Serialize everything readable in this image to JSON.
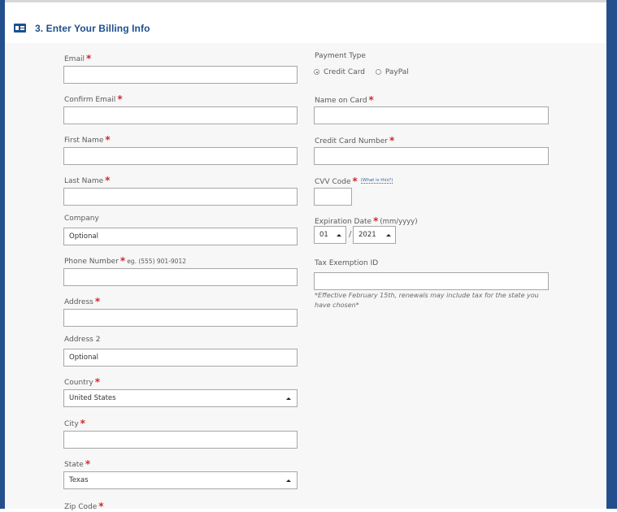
{
  "section": {
    "title": "3. Enter Your Billing Info",
    "icon": "id-card-icon"
  },
  "left_fields": [
    {
      "label": "Email",
      "required": true,
      "value": "",
      "placeholder": ""
    },
    {
      "label": "Confirm Email",
      "required": true,
      "value": "",
      "placeholder": ""
    },
    {
      "label": "First Name",
      "required": true,
      "value": "",
      "placeholder": ""
    },
    {
      "label": "Last Name",
      "required": true,
      "value": "",
      "placeholder": ""
    },
    {
      "label": "Company",
      "required": false,
      "value": "",
      "placeholder": "Optional"
    },
    {
      "label": "Phone Number",
      "required": true,
      "hint": "eg. (555) 901-9012",
      "value": "",
      "placeholder": ""
    },
    {
      "label": "Address",
      "required": true,
      "value": "",
      "placeholder": ""
    },
    {
      "label": "Address 2",
      "required": false,
      "value": "",
      "placeholder": "Optional"
    },
    {
      "label": "Country",
      "required": true,
      "value": "United States",
      "type": "select"
    },
    {
      "label": "City",
      "required": true,
      "value": "",
      "placeholder": ""
    },
    {
      "label": "State",
      "required": true,
      "value": "Texas",
      "type": "select"
    },
    {
      "label": "Zip Code",
      "required": true
    }
  ],
  "payment": {
    "type_label": "Payment Type",
    "options": [
      {
        "label": "Credit Card",
        "selected": true
      },
      {
        "label": "PayPal",
        "selected": false
      }
    ],
    "name_on_card_label": "Name on Card",
    "card_number_label": "Credit Card Number",
    "cvv_label": "CVV Code",
    "cvv_help": "(What is this?)",
    "expiration_label": "Expiration Date",
    "expiration_hint": "(mm/yyyy)",
    "exp_month": "01",
    "exp_separator": "/",
    "exp_year": "2021",
    "tax_label": "Tax Exemption ID",
    "tax_note": "*Effective February 15th, renewals may include tax for the state you have chosen*"
  },
  "required_mark": "*",
  "colors": {
    "brand_blue": "#1d4f8e",
    "required_red": "#d0292b",
    "form_background": "#f7f7f7"
  }
}
